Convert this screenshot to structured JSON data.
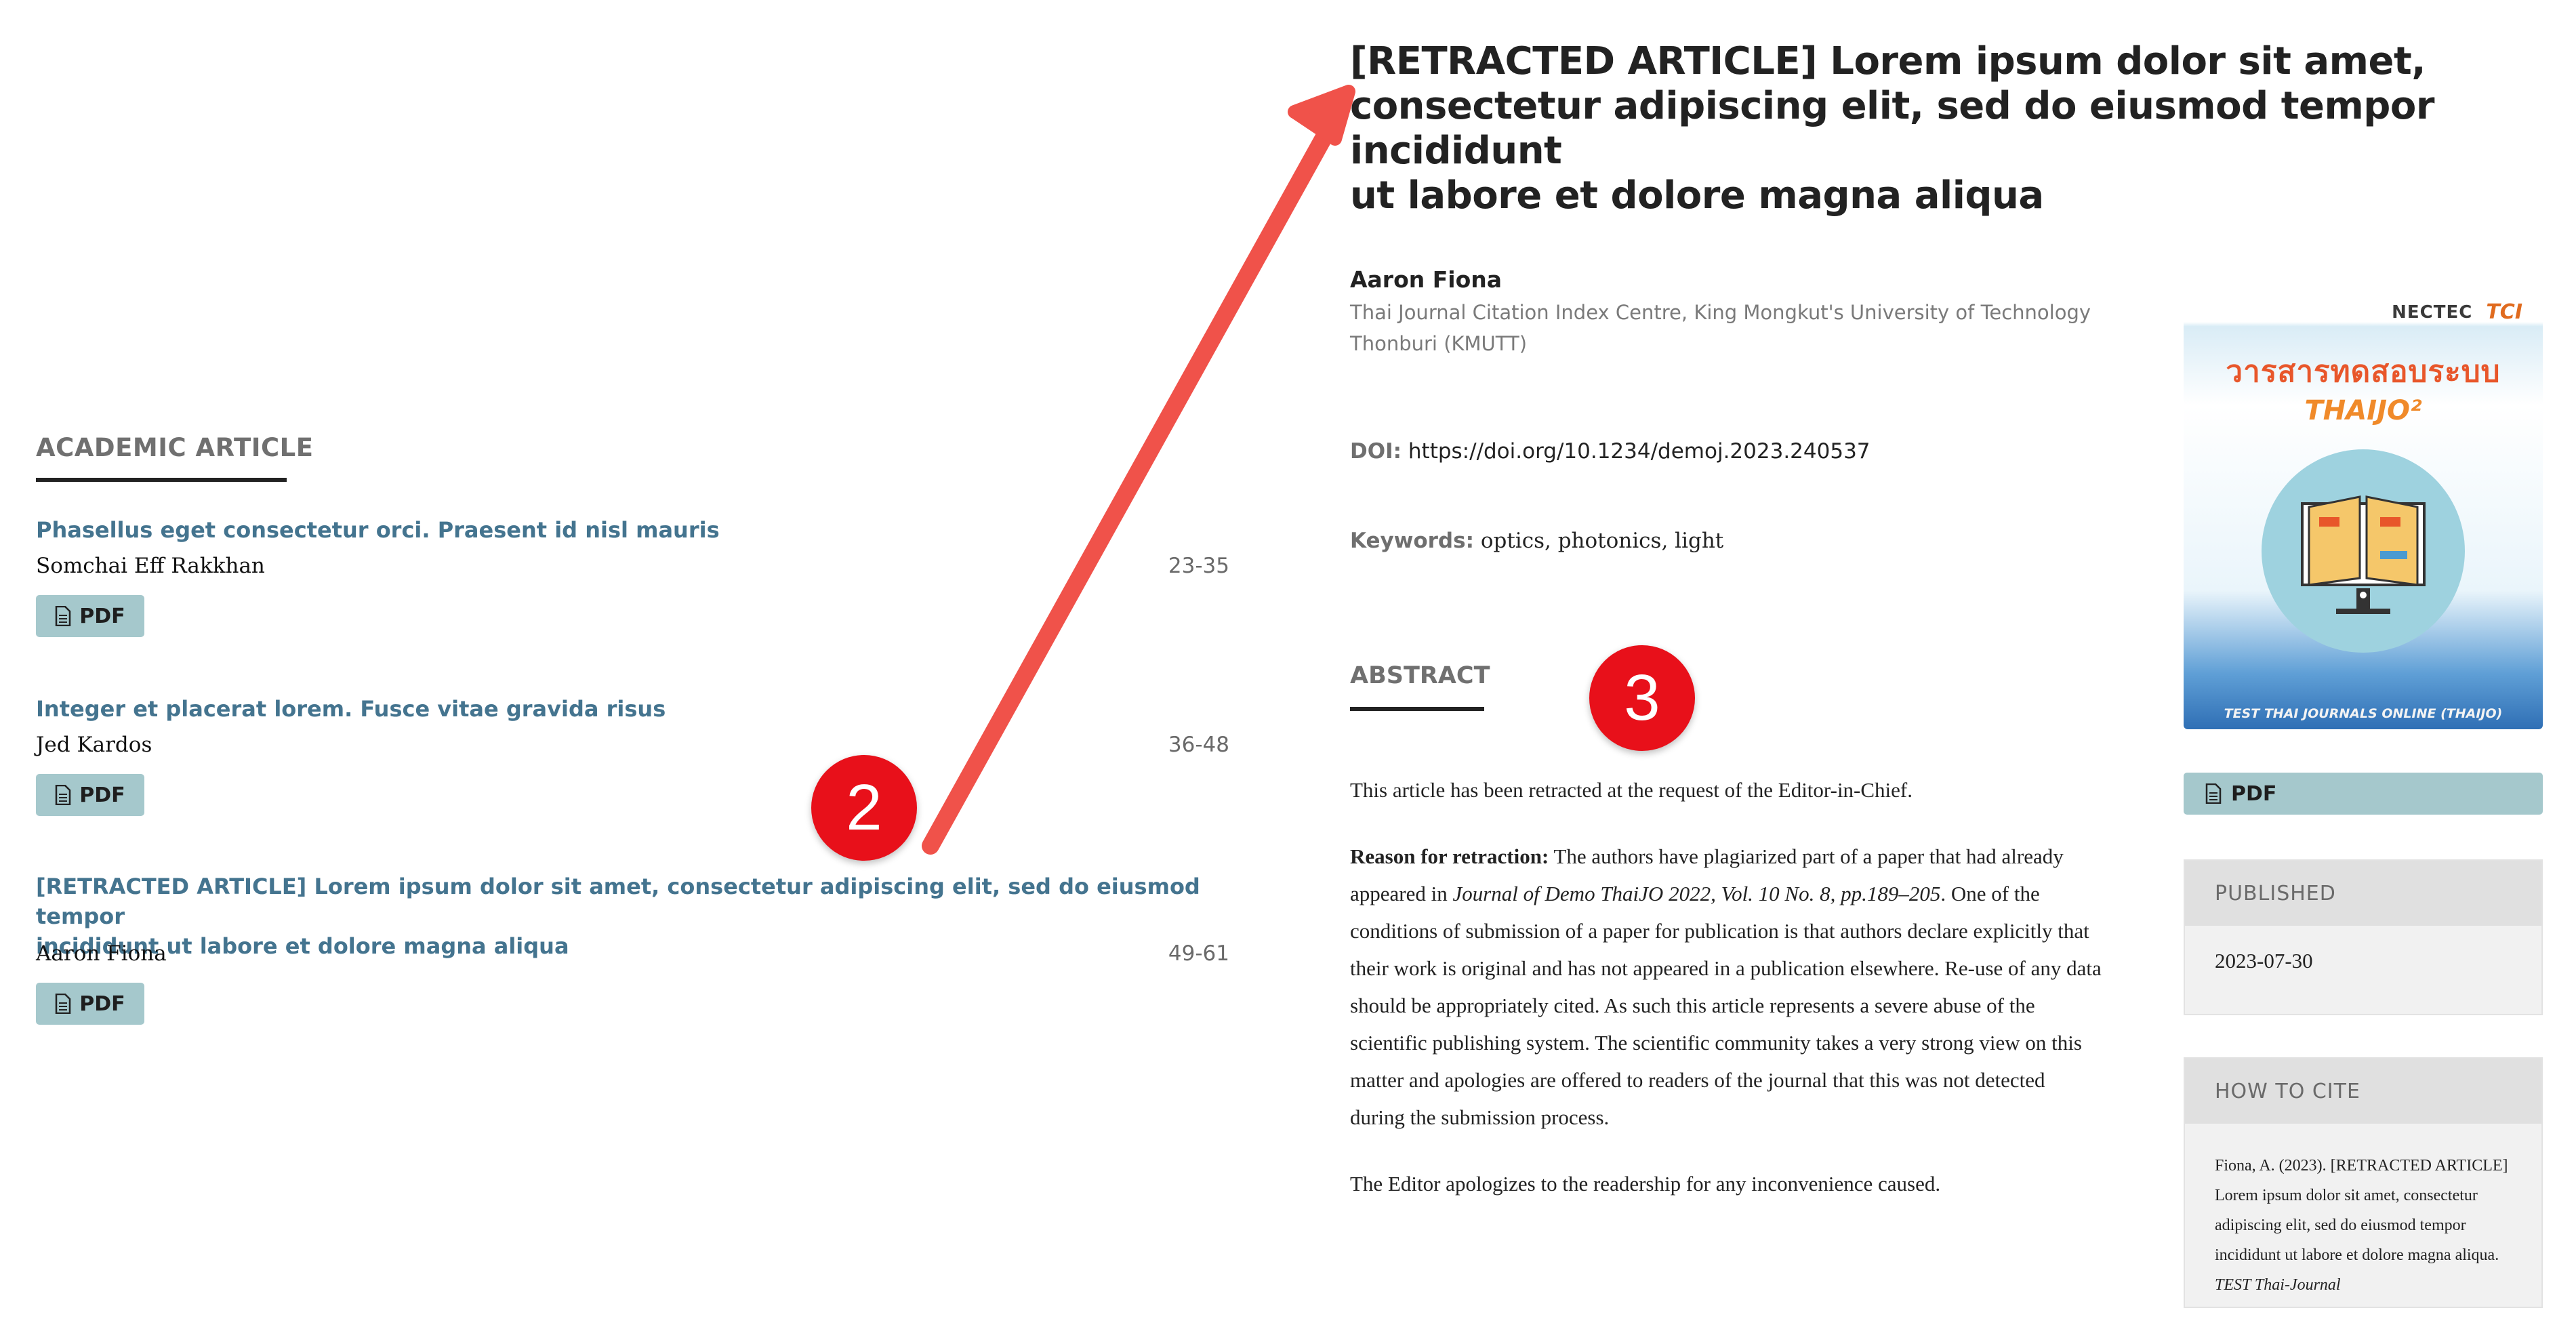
{
  "left": {
    "section_heading": "ACADEMIC ARTICLE",
    "articles": [
      {
        "title": "Phasellus eget consectetur orci. Praesent id nisl mauris",
        "author": "Somchai Eff Rakkhan",
        "pages": "23-35",
        "pdf_label": "PDF"
      },
      {
        "title": "Integer et placerat lorem. Fusce vitae gravida risus",
        "author": "Jed Kardos",
        "pages": "36-48",
        "pdf_label": "PDF"
      },
      {
        "title_line1": "[RETRACTED ARTICLE] Lorem ipsum dolor sit amet, consectetur adipiscing elit, sed do eiusmod tempor",
        "title_line2": "incididunt ut labore et dolore magna aliqua",
        "author": "Aaron Fiona",
        "pages": "49-61",
        "pdf_label": "PDF"
      }
    ]
  },
  "article": {
    "title_line1": "[RETRACTED ARTICLE] Lorem ipsum dolor sit amet,",
    "title_line2": "consectetur adipiscing elit, sed do eiusmod tempor incididunt",
    "title_line3": "ut labore et dolore magna aliqua",
    "author": "Aaron Fiona",
    "affiliation_line1": "Thai Journal Citation Index Centre, King Mongkut's University of Technology",
    "affiliation_line2": "Thonburi (KMUTT)",
    "doi_label": "DOI:",
    "doi_value": "https://doi.org/10.1234/demoj.2023.240537",
    "keywords_label": "Keywords:",
    "keywords_value": "optics, photonics, light",
    "abstract_heading": "ABSTRACT",
    "abstract_p1": "This article has been retracted at the request of the Editor-in-Chief.",
    "reason_label": "Reason for retraction:",
    "reason_text_a": " The authors have plagiarized part of a paper that had already appeared in ",
    "reason_journal": "Journal of Demo ThaiJO 2022, Vol. 10 No. 8, pp.189–205",
    "reason_text_b": ". One of the conditions of submission of a paper for publication is that authors declare explicitly that their work is original and has not appeared in a publication elsewhere. Re-use of any data should be appropriately cited. As such this article represents a severe abuse of the scientific publishing system. The scientific community takes a very strong view on this matter and apologies are offered to readers of the journal that this was not detected during the submission process.",
    "abstract_p3": "The Editor apologizes to the readership for any inconvenience caused."
  },
  "sidebar": {
    "cover": {
      "brand_nectec": "NECTEC",
      "brand_tci": "TCI",
      "thai_title": "วารสารทดสอบระบบ",
      "thaijo": "THAIJO²",
      "footer": "TEST THAI JOURNALS ONLINE (THAIJO)"
    },
    "pdf_label": "PDF",
    "published_heading": "PUBLISHED",
    "published_date": "2023-07-30",
    "cite_heading": "HOW TO CITE",
    "cite_text_a": "Fiona, A. (2023). [RETRACTED ARTICLE] Lorem ipsum dolor sit amet, consectetur adipiscing elit, sed do eiusmod tempor incididunt ut labore et dolore magna aliqua. ",
    "cite_journal": "TEST Thai-Journal"
  },
  "annotations": {
    "badge_2": "2",
    "badge_3": "3"
  },
  "colors": {
    "link": "#44748f",
    "pdf_button": "#a5c8cc",
    "badge": "#e8101a",
    "arrow": "#f0524a"
  }
}
